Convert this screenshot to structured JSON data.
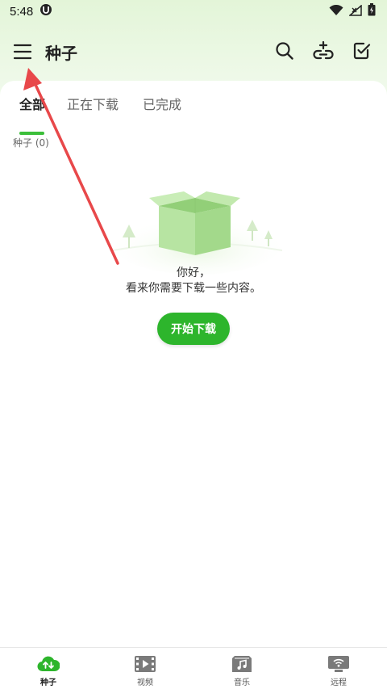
{
  "status_bar": {
    "time": "5:48",
    "icons": [
      "app-notification-icon",
      "wifi-icon",
      "no-signal-icon",
      "battery-icon"
    ]
  },
  "app_bar": {
    "title": "种子",
    "icons": [
      "menu-icon",
      "search-icon",
      "add-link-icon",
      "select-check-icon"
    ]
  },
  "tabs": [
    {
      "label": "全部",
      "active": true
    },
    {
      "label": "正在下载",
      "active": false
    },
    {
      "label": "已完成",
      "active": false
    }
  ],
  "torrent_count_label": "种子 (0)",
  "empty_state": {
    "line1": "你好，",
    "line2": "看来你需要下载一些内容。",
    "button_label": "开始下载",
    "illustration": "open-box-icon"
  },
  "bottom_nav": [
    {
      "label": "种子",
      "icon": "cloud-torrent-icon",
      "active": true
    },
    {
      "label": "视频",
      "icon": "video-film-icon",
      "active": false
    },
    {
      "label": "音乐",
      "icon": "music-icon",
      "active": false
    },
    {
      "label": "远程",
      "icon": "remote-monitor-icon",
      "active": false
    }
  ],
  "colors": {
    "accent_green": "#2db52c",
    "tab_indicator": "#3cbf3a",
    "header_gradient_top": "#e3f5d8",
    "annotation_arrow": "#e8484a"
  }
}
